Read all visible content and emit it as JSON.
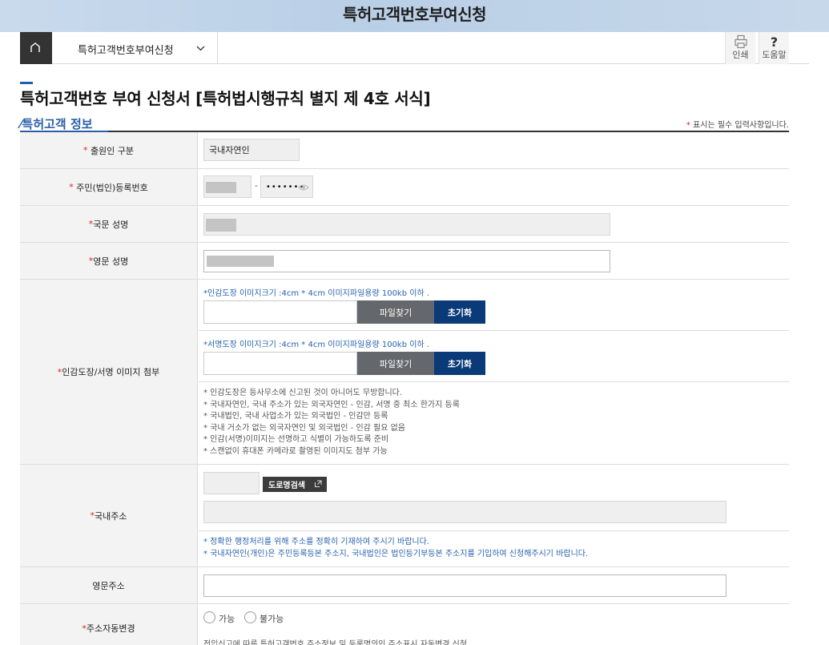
{
  "banner_title": "특허고객번호부여신청",
  "topbar": {
    "menu_label": "특허고객번호부여신청",
    "print_label": "인쇄",
    "help_label": "도움말",
    "help_glyph": "?"
  },
  "page_title": "특허고객번호 부여 신청서 [특허법시행규칙 별지 제 4호 서식]",
  "section": {
    "title": "특허고객 정보",
    "required_mark": "*",
    "required_note": " 표시는 필수 입력사항입니다."
  },
  "fields": {
    "applicant_type": {
      "label": "출원인 구분",
      "required": "*",
      "value": "국내자연인"
    },
    "reg_number": {
      "label": "주민(법인)등록번호",
      "required": "*",
      "separator": "-",
      "masked_value": "•••••••"
    },
    "korean_name": {
      "label": "국문 성명",
      "required": "*"
    },
    "english_name": {
      "label": "영문 성명",
      "required": "*"
    },
    "seal": {
      "label": "인감도장/서명 이미지 첨부",
      "required": "*",
      "seal_hint": "*인감도장 이미지크기 :4cm * 4cm 이미지파일용량 100kb 이하 .",
      "sign_hint": "*서명도장 이미지크기 :4cm * 4cm 이미지파일용량 100kb 이하 .",
      "find_label": "파일찾기",
      "reset_label": "초기화",
      "notes": [
        "* 인감도장은 등사무소에 신고된 것이 아니어도 무방합니다.",
        "* 국내자연인, 국내 주소가 있는 외국자연인 - 인감, 서명 중 최소 한가지 등록",
        "* 국내법인, 국내 사업소가 있는 외국법인 - 인감만 등록",
        "* 국내 거소가 없는 외국자연인 및 외국법인 - 인감 필요 없음",
        "* 인감(서명)이미지는 선명하고 식별이 가능하도록 준비",
        "* 스캔없이 휴대폰 카메라로 촬영된 이미지도 첨부 가능"
      ]
    },
    "domestic_address": {
      "label": "국내주소",
      "required": "*",
      "search_label": "도로명검색",
      "notes": [
        "* 정확한 행정처리를 위해 주소를 정확히 기재하여 주시기 바랍니다.",
        "* 국내자연인(개인)은 주민등록등본 주소지, 국내법인은 법인등기부등본 주소지를 기입하여 신청해주시기 바랍니다."
      ]
    },
    "english_address": {
      "label": "영문주소"
    },
    "auto_change": {
      "label": "주소자동변경",
      "required": "*",
      "options": [
        "가능",
        "불가능"
      ],
      "note": "전입신고에 따른 특허고객번호 주소정보 및 등록명의인 주소표시 자동변경 신청"
    }
  }
}
